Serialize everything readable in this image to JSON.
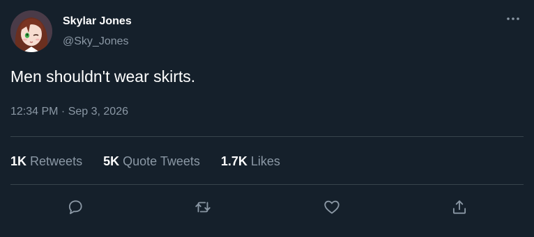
{
  "user": {
    "display_name": "Skylar Jones",
    "handle": "@Sky_Jones",
    "avatar_icon": "anime-girl-avatar"
  },
  "tweet": {
    "text": "Men shouldn't wear skirts.",
    "timestamp": "12:34 PM · Sep 3, 2026"
  },
  "stats": {
    "retweets_count": "1K",
    "retweets_label": "Retweets",
    "quotes_count": "5K",
    "quotes_label": "Quote Tweets",
    "likes_count": "1.7K",
    "likes_label": "Likes"
  },
  "actions": {
    "reply_icon": "reply-icon",
    "retweet_icon": "retweet-icon",
    "like_icon": "heart-icon",
    "share_icon": "share-icon"
  },
  "colors": {
    "background": "#15202b",
    "secondary_text": "#8b98a5",
    "divider": "#38444d"
  }
}
